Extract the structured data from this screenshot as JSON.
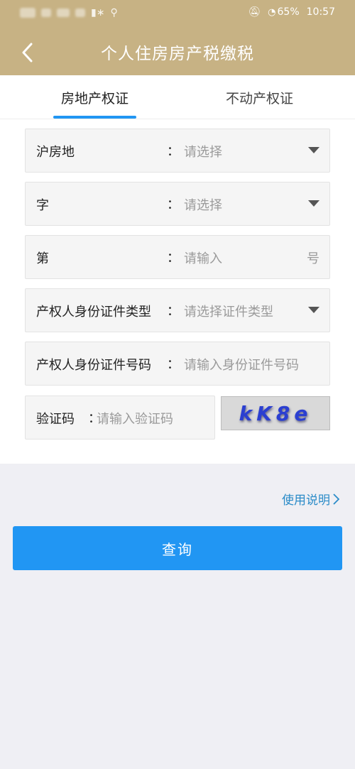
{
  "status_bar": {
    "battery": "65%",
    "time": "10:57"
  },
  "header": {
    "title": "个人住房房产税缴税"
  },
  "tabs": [
    {
      "label": "房地产权证",
      "active": true
    },
    {
      "label": "不动产权证",
      "active": false
    }
  ],
  "form": {
    "district": {
      "label": "沪房地",
      "placeholder": "请选择"
    },
    "word": {
      "label": "字",
      "placeholder": "请选择"
    },
    "number": {
      "label": "第",
      "placeholder": "请输入",
      "suffix": "号"
    },
    "id_type": {
      "label": "产权人身份证件类型",
      "placeholder": "请选择证件类型"
    },
    "id_number": {
      "label": "产权人身份证件号码",
      "placeholder": "请输入身份证件号码"
    },
    "captcha": {
      "label": "验证码",
      "placeholder": "请输入验证码",
      "image_text": "kK8e"
    },
    "colon": "："
  },
  "help_link": "使用说明",
  "query_button": "查询",
  "colors": {
    "header": "#c7b284",
    "accent": "#2196f3",
    "link": "#2a8bc8"
  }
}
